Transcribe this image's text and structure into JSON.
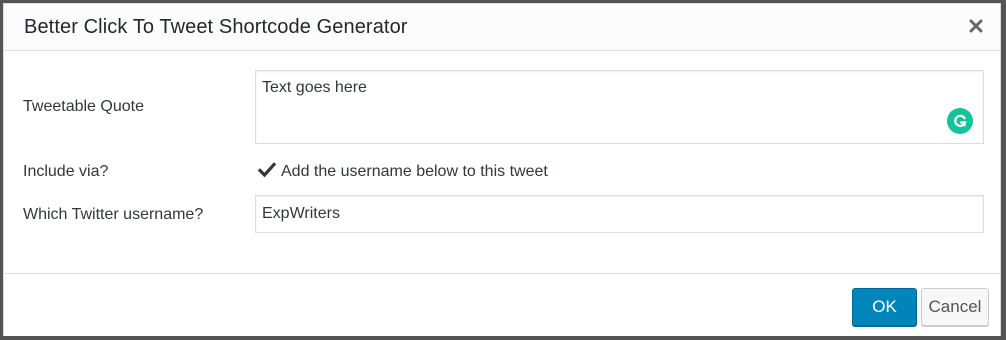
{
  "dialog": {
    "title": "Better Click To Tweet Shortcode Generator",
    "close_icon": "close-icon"
  },
  "form": {
    "quote_label": "Tweetable Quote",
    "quote_value": "Text goes here",
    "grammarly_icon": "grammarly-icon",
    "via_label": "Include via?",
    "via_checked": true,
    "via_checkbox_label": "Add the username below to this tweet",
    "username_label": "Which Twitter username?",
    "username_value": "ExpWriters"
  },
  "footer": {
    "ok_label": "OK",
    "cancel_label": "Cancel"
  },
  "colors": {
    "primary": "#0085ba",
    "grammarly": "#15c39a"
  }
}
